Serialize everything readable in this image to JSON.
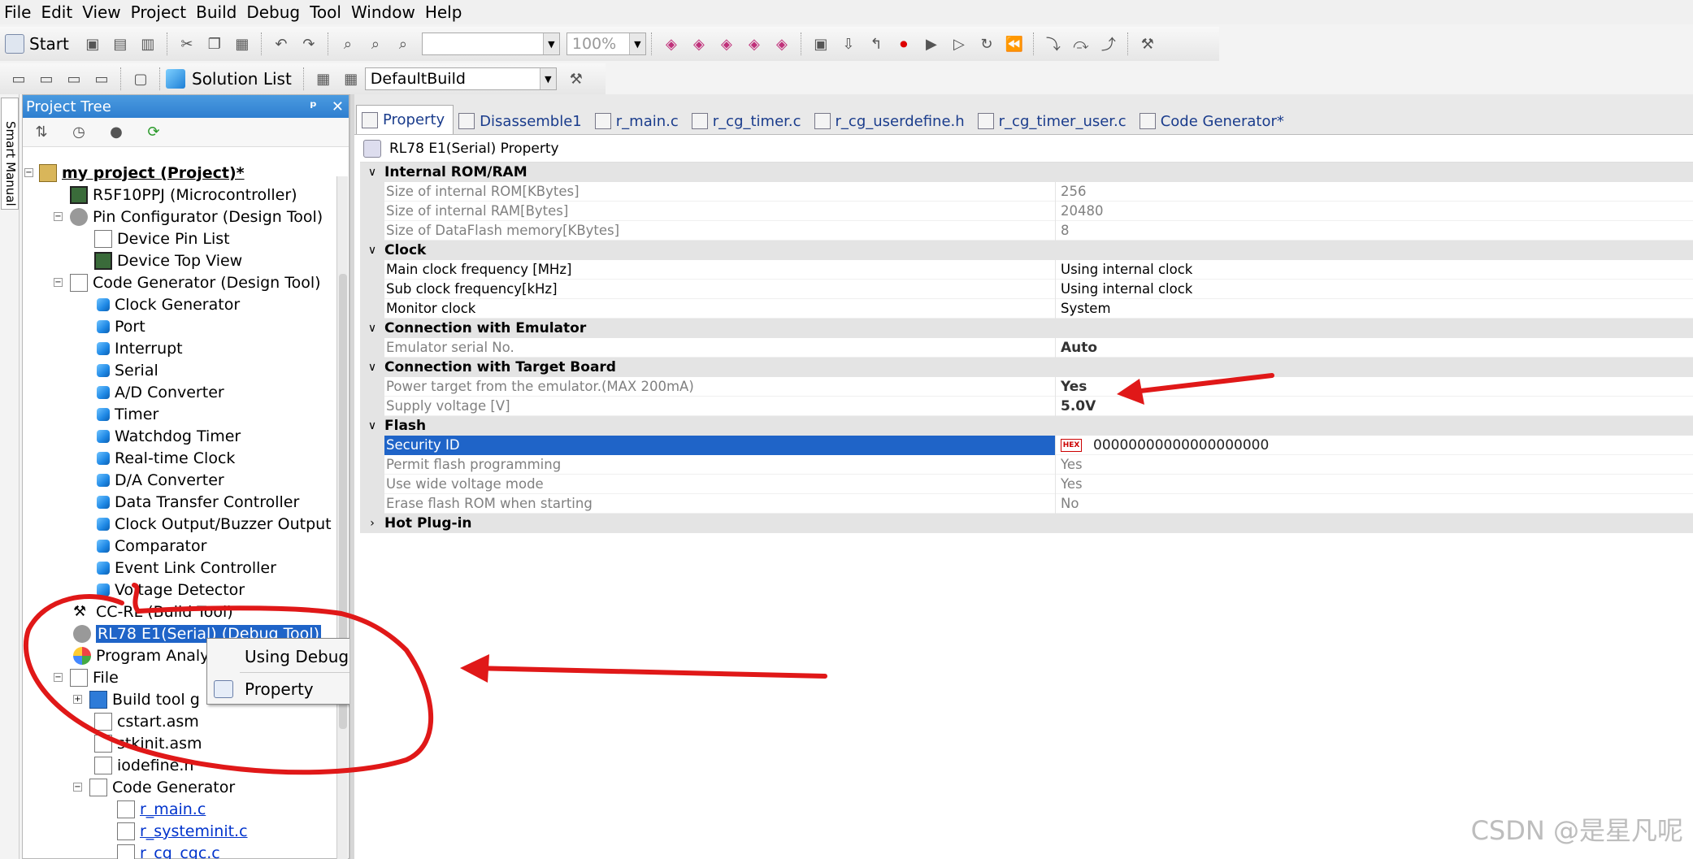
{
  "menu": [
    "File",
    "Edit",
    "View",
    "Project",
    "Build",
    "Debug",
    "Tool",
    "Window",
    "Help"
  ],
  "toolbar": {
    "start_label": "Start",
    "zoom_value": "100%",
    "solution_list_label": "Solution List",
    "build_config": "DefaultBuild"
  },
  "sidebar_strip": {
    "label": "Smart Manual"
  },
  "project_tree": {
    "title": "Project Tree",
    "pin_label": "ᵖ",
    "close_label": "✕",
    "nodes": [
      "my project (Project)*",
      "R5F10PPJ (Microcontroller)",
      "Pin Configurator (Design Tool)",
      "Device Pin List",
      "Device Top View",
      "Code Generator (Design Tool)",
      "Clock Generator",
      "Port",
      "Interrupt",
      "Serial",
      "A/D Converter",
      "Timer",
      "Watchdog Timer",
      "Real-time Clock",
      "D/A Converter",
      "Data Transfer Controller",
      "Clock Output/Buzzer Output",
      "Comparator",
      "Event Link Controller",
      "Voltage Detector",
      "CC-RL (Build Tool)",
      "RL78 E1(Serial) (Debug Tool)",
      "Program Analyz",
      "File",
      "Build tool g",
      "cstart.asm",
      "stkinit.asm",
      "iodefine.h",
      "Code Generator",
      "r_main.c",
      "r_systeminit.c",
      "r_cg_cgc.c"
    ]
  },
  "context_menu": {
    "items": [
      "Using Debug Tool",
      "Property"
    ]
  },
  "tabs": [
    "Property",
    "Disassemble1",
    "r_main.c",
    "r_cg_timer.c",
    "r_cg_userdefine.h",
    "r_cg_timer_user.c",
    "Code Generator*"
  ],
  "property": {
    "header": "RL78 E1(Serial) Property",
    "categories": [
      {
        "name": "Internal ROM/RAM",
        "chevron": "∨",
        "rows": [
          {
            "name": "Size of internal ROM[KBytes]",
            "value": "256"
          },
          {
            "name": "Size of internal RAM[Bytes]",
            "value": "20480"
          },
          {
            "name": "Size of DataFlash memory[KBytes]",
            "value": "8"
          }
        ]
      },
      {
        "name": "Clock",
        "chevron": "∨",
        "rows": [
          {
            "name": "Main clock frequency [MHz]",
            "value": "Using internal clock"
          },
          {
            "name": "Sub clock frequency[kHz]",
            "value": "Using internal clock"
          },
          {
            "name": "Monitor clock",
            "value": "System"
          }
        ]
      },
      {
        "name": "Connection with Emulator",
        "chevron": "∨",
        "rows": [
          {
            "name": "Emulator serial No.",
            "value": "Auto"
          }
        ]
      },
      {
        "name": "Connection with Target Board",
        "chevron": "∨",
        "rows": [
          {
            "name": "Power target from the emulator.(MAX 200mA)",
            "value": "Yes"
          },
          {
            "name": "Supply voltage [V]",
            "value": "5.0V"
          }
        ]
      },
      {
        "name": "Flash",
        "chevron": "∨",
        "rows": [
          {
            "name": "Security ID",
            "value": "00000000000000000000",
            "badge": "HEX"
          },
          {
            "name": "Permit flash programming",
            "value": "Yes"
          },
          {
            "name": "Use wide voltage mode",
            "value": "Yes"
          },
          {
            "name": "Erase flash ROM when starting",
            "value": "No"
          }
        ]
      },
      {
        "name": "Hot Plug-in",
        "chevron": "›",
        "rows": []
      }
    ]
  },
  "watermark": "CSDN @是星凡呢",
  "colors": {
    "selection": "#1f64c8",
    "annotation_red": "#e01818",
    "title_blue": "#2f7fd0"
  }
}
